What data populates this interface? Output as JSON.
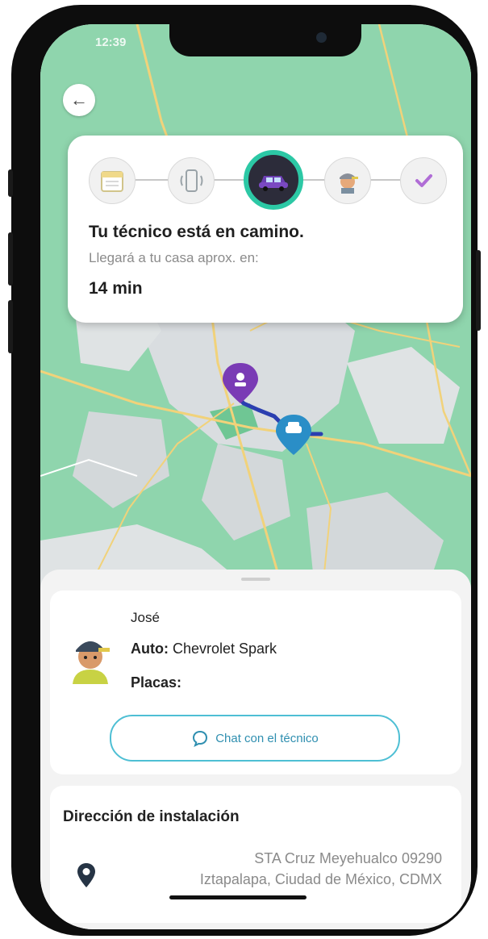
{
  "status_bar": {
    "time": "12:39"
  },
  "status": {
    "title": "Tu técnico está en camino.",
    "subtitle": "Llegará a tu casa aprox. en:",
    "eta": "14 min",
    "steps": [
      "calendar-icon",
      "phone-vibrate-icon",
      "car-icon",
      "technician-icon",
      "check-icon"
    ],
    "active_step": 3
  },
  "technician": {
    "name": "José",
    "auto_label": "Auto:",
    "auto_value": " Chevrolet Spark",
    "plates_label": "Placas:",
    "chat_label": "Chat con el técnico"
  },
  "address": {
    "title": "Dirección de instalación",
    "line1": "STA Cruz Meyehualco 09290",
    "line2": "Iztapalapa, Ciudad de México, CDMX"
  },
  "colors": {
    "accent": "#2cc8a5",
    "map_green": "#8fd5ad",
    "route": "#2b3fb0",
    "destination_pin": "#7a3bb5",
    "car_pin": "#2a8ec7"
  }
}
